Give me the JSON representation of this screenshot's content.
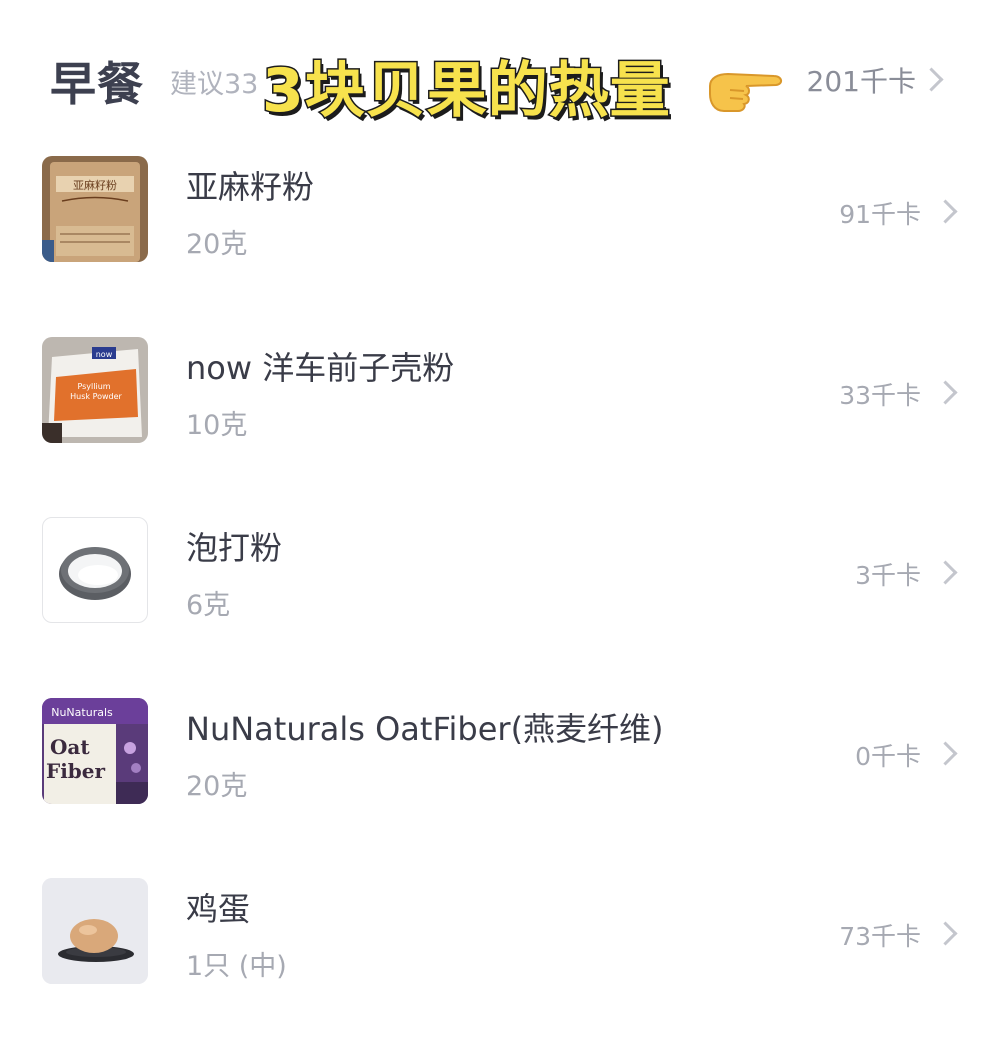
{
  "meal": {
    "title": "早餐",
    "suggestion": "建议33",
    "total_kcal": "201千卡"
  },
  "overlay": {
    "caption": "3块贝果的热量",
    "emoji": "pointing-right-hand-icon"
  },
  "items": [
    {
      "name": "亚麻籽粉",
      "amount": "20克",
      "kcal": "91千卡",
      "image": "flaxseed-flour-bag"
    },
    {
      "name": "now 洋车前子壳粉",
      "amount": "10克",
      "kcal": "33千卡",
      "image": "psyllium-husk-powder-bag"
    },
    {
      "name": "泡打粉",
      "amount": "6克",
      "kcal": "3千卡",
      "image": "baking-powder-bowl"
    },
    {
      "name": "NuNaturals OatFiber(燕麦纤维)",
      "amount": "20克",
      "kcal": "0千卡",
      "image": "oat-fiber-bag"
    },
    {
      "name": "鸡蛋",
      "amount": "1只 (中)",
      "kcal": "73千卡",
      "image": "egg-on-plate"
    }
  ],
  "colors": {
    "title": "#3d4050",
    "muted": "#a6a9b2",
    "caption_fill": "#f7e24d",
    "caption_stroke": "#1c1c1c"
  }
}
